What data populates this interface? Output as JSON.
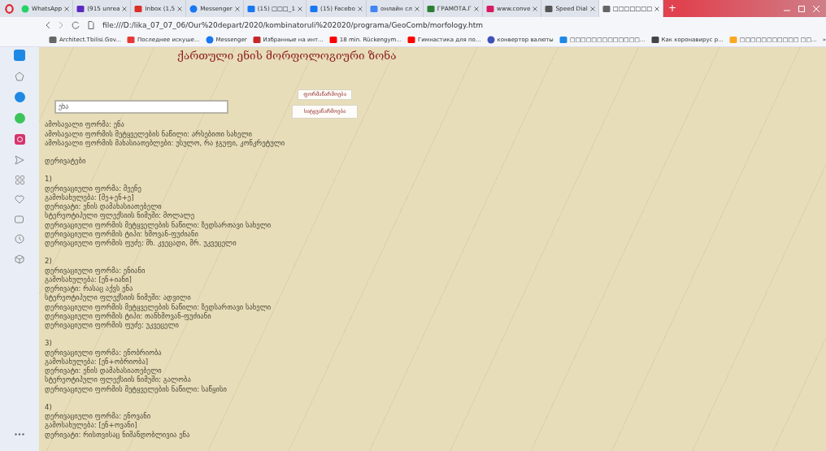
{
  "browser": {
    "tabs": [
      {
        "label": "WhatsApp",
        "kind": "whatsapp",
        "selected": false
      },
      {
        "label": "(915 unrea",
        "kind": "mail",
        "selected": false
      },
      {
        "label": "Inbox (1,5",
        "kind": "gmail",
        "selected": false
      },
      {
        "label": "Messenger",
        "kind": "messenger",
        "selected": false
      },
      {
        "label": "(15) □□□_1",
        "kind": "facebook",
        "selected": false
      },
      {
        "label": "(15) Facebo",
        "kind": "facebook",
        "selected": false
      },
      {
        "label": "онлайн сл",
        "kind": "google",
        "selected": false
      },
      {
        "label": "ГРАМОТА.Г",
        "kind": "gramota",
        "selected": false
      },
      {
        "label": "www.conve",
        "kind": "pink",
        "selected": false
      },
      {
        "label": "Speed Dial",
        "kind": "grid",
        "selected": false
      },
      {
        "label": "□□□□□□□",
        "kind": "page",
        "selected": true
      }
    ],
    "address": "file:///D:/lika_07_07_06/Our%20depart/2020/kombinatoruli%202020/programa/GeoComb/morfology.htm",
    "bookmarks": [
      {
        "label": "Architect.Tbilisi.Gov...",
        "kind": "page"
      },
      {
        "label": "Последнее искуше...",
        "kind": "red"
      },
      {
        "label": "Messenger",
        "kind": "messenger"
      },
      {
        "label": "Избранные на инт...",
        "kind": "building"
      },
      {
        "label": "18 min. Rückengym...",
        "kind": "youtube"
      },
      {
        "label": "Гимнастика для по...",
        "kind": "youtube"
      },
      {
        "label": "конвертор валюты",
        "kind": "pin"
      },
      {
        "label": "□□□□□□□□□□□□□...",
        "kind": "blue"
      },
      {
        "label": "Как коронавирус р...",
        "kind": "dash"
      },
      {
        "label": "□□□□□□□□□□□ □□...",
        "kind": "orange"
      }
    ],
    "bookmarks_more": "»",
    "new_tab": "+"
  },
  "page": {
    "title": "ქართული ენის მორფოლოგიური ზონა",
    "input": {
      "value": "ენა"
    },
    "buttons": [
      "ფორმაწარმოება",
      "სიტყვაწარმოება"
    ],
    "summary": [
      "ამოსავალი ფორმა: ენა",
      "ამოსავალი ფორმის მეტყველების ნაწილი: არსებითი სახელი",
      "ამოსავალი ფორმის მახასიათებლები: უსულო, რა ჯგუფი, კონკრეტული"
    ],
    "derivatives_heading": "დერივატები",
    "derivatives": [
      {
        "number": "1)",
        "lines": [
          "დერივაციული ფორმა: მეენე",
          "გამოსახულება: [მე+ენ+ე]",
          "დერივატი: ენის დამახასიათებელი",
          "სტერეოტიპული ფლექსიის ნიმუში: მოლალე",
          "დერივაციული ფორმის მეტყველების ნაწილი: ზედსართავი სახელი",
          "დერივაციული ფორმის ტიპი: ხმოვან-ფუძიანი",
          "დერივაციული ფორმის ფუძე: მხ. კვეცადი, მრ. უკვეცელი"
        ]
      },
      {
        "number": "2)",
        "lines": [
          "დერივაციული ფორმა: ენიანი",
          "გამოსახულება: [ენ+იანი]",
          "დერივატი: რასაც აქვს ენა",
          "სტერეოტიპული ფლექსიის ნიმუში: ადვილი",
          "დერივაციული ფორმის მეტყველების ნაწილი: ზედსართავი სახელი",
          "დერივაციული ფორმის ტიპი: თანხმოვან-ფუძიანი",
          "დერივაციული ფორმის ფუძე: უკვეცელი"
        ]
      },
      {
        "number": "3)",
        "lines": [
          "დერივაციული ფორმა: ენობრიობა",
          "გამოსახულება: [ენ+ობრიობა]",
          "დერივატი: ენის დამახასიათებელი",
          "სტერეოტიპული ფლექსიის ნიმუში: გალობა",
          "დერივაციული ფორმის მეტყველების ნაწილი: საწყისი"
        ]
      },
      {
        "number": "4)",
        "lines": [
          "დერივაციული ფორმა: ენოვანი",
          "გამოსახულება: [ენ+ოვანი]",
          "დერივატი: რისთვისაც ნიშანდობლივია ენა"
        ]
      }
    ]
  }
}
